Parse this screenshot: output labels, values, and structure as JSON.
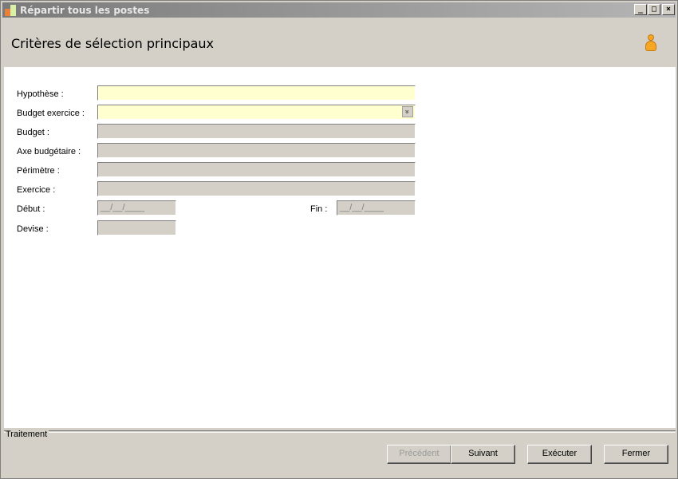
{
  "window": {
    "title": "Répartir tous les postes",
    "controls": {
      "minimize": "_",
      "maximize": "□",
      "close": "×"
    }
  },
  "header": {
    "title": "Critères de sélection principaux",
    "icon": "user-icon"
  },
  "form": {
    "hypothese": {
      "label": "Hypothèse :",
      "value": ""
    },
    "budget_exercice": {
      "label": "Budget exercice :",
      "value": "",
      "dropdown_glyph": "»"
    },
    "budget": {
      "label": "Budget :",
      "value": ""
    },
    "axe_budgetaire": {
      "label": "Axe budgétaire :",
      "value": ""
    },
    "perimetre": {
      "label": "Périmètre :",
      "value": ""
    },
    "exercice": {
      "label": "Exercice :",
      "value": ""
    },
    "debut": {
      "label": "Début :",
      "value": "__/__/____"
    },
    "fin": {
      "label": "Fin :",
      "value": "__/__/____"
    },
    "devise": {
      "label": "Devise :",
      "value": ""
    }
  },
  "footer": {
    "group_label": "Traitement",
    "buttons": {
      "precedent": "Précédent",
      "suivant": "Suivant",
      "executer": "Exécuter",
      "fermer": "Fermer"
    }
  },
  "colors": {
    "title_bar_start": "#7a7a7a",
    "title_bar_end": "#b5b5b5",
    "required_field": "#ffffd0",
    "readonly_field": "#d4d0c8",
    "user_icon": "#f5a623"
  }
}
